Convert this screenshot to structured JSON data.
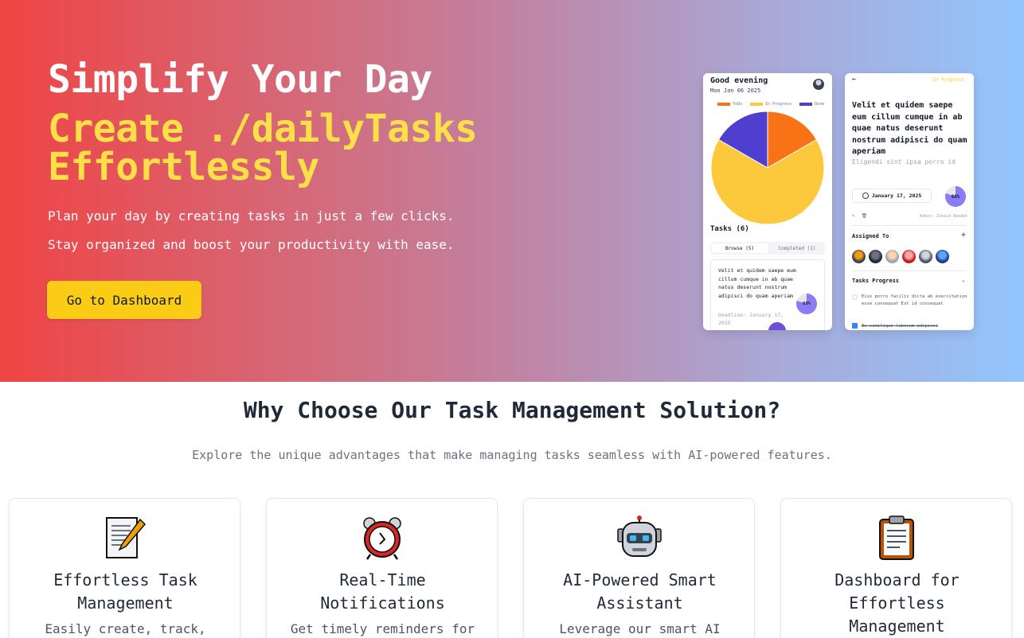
{
  "hero": {
    "title": "Simplify Your Day",
    "subtitle": "Create ./dailyTasks Effortlessly",
    "line1": "Plan your day by creating tasks in just a few clicks.",
    "line2": "Stay organized and boost your productivity with ease.",
    "cta": "Go to Dashboard"
  },
  "phone1": {
    "greeting": "Good evening",
    "date": "Mon Jan 06 2025",
    "legend": [
      "ToDo",
      "In Progress",
      "Done"
    ],
    "tasks_heading": "Tasks (6)",
    "tabs": [
      "Browse (5)",
      "Completed (1)"
    ],
    "task_text": "Velit et quidem saepe eum cillum cumque in ab quae natus deserunt nostrum adipisci do quam aperiam",
    "task_deadline": "Deadline: January 17, 2025",
    "task_pct": "80%"
  },
  "phone2": {
    "back": "←",
    "status": "In Progress",
    "title": "Velit et quidem saepe eum cillum cumque in ab quae natus deserunt nostrum adipisci do quam aperiam",
    "desc": "Eligendi sint ipsa porro id",
    "date": "January 17, 2025",
    "pct": "80%",
    "admin": "Admin: Zonaid Abedeh",
    "assigned_heading": "Assigned To",
    "plus": "+",
    "progress_heading": "Tasks Progress",
    "chevron": "⌄",
    "item1": "Eius porro facilis dicta ab exercitation esse consequat Est id consequat",
    "item2": "Ea similique laborum adipisci"
  },
  "features": {
    "heading": "Why Choose Our Task Management Solution?",
    "subheading": "Explore the unique advantages that make managing tasks seamless with AI-powered features.",
    "cards": [
      {
        "title": "Effortless Task Management",
        "desc": "Easily create, track,",
        "icon": "memo-pencil-icon"
      },
      {
        "title": "Real-Time Notifications",
        "desc": "Get timely reminders for",
        "icon": "alarm-clock-icon"
      },
      {
        "title": "AI-Powered Smart Assistant",
        "desc": "Leverage our smart AI",
        "icon": "robot-icon"
      },
      {
        "title": "Dashboard for Effortless Management",
        "desc": "",
        "icon": "clipboard-icon"
      }
    ]
  },
  "chart_data": {
    "type": "pie",
    "categories": [
      "ToDo",
      "In Progress",
      "Done"
    ],
    "values": [
      1,
      4,
      1
    ],
    "colors": [
      "#f97316",
      "#fcc93d",
      "#4f3fd0"
    ]
  }
}
